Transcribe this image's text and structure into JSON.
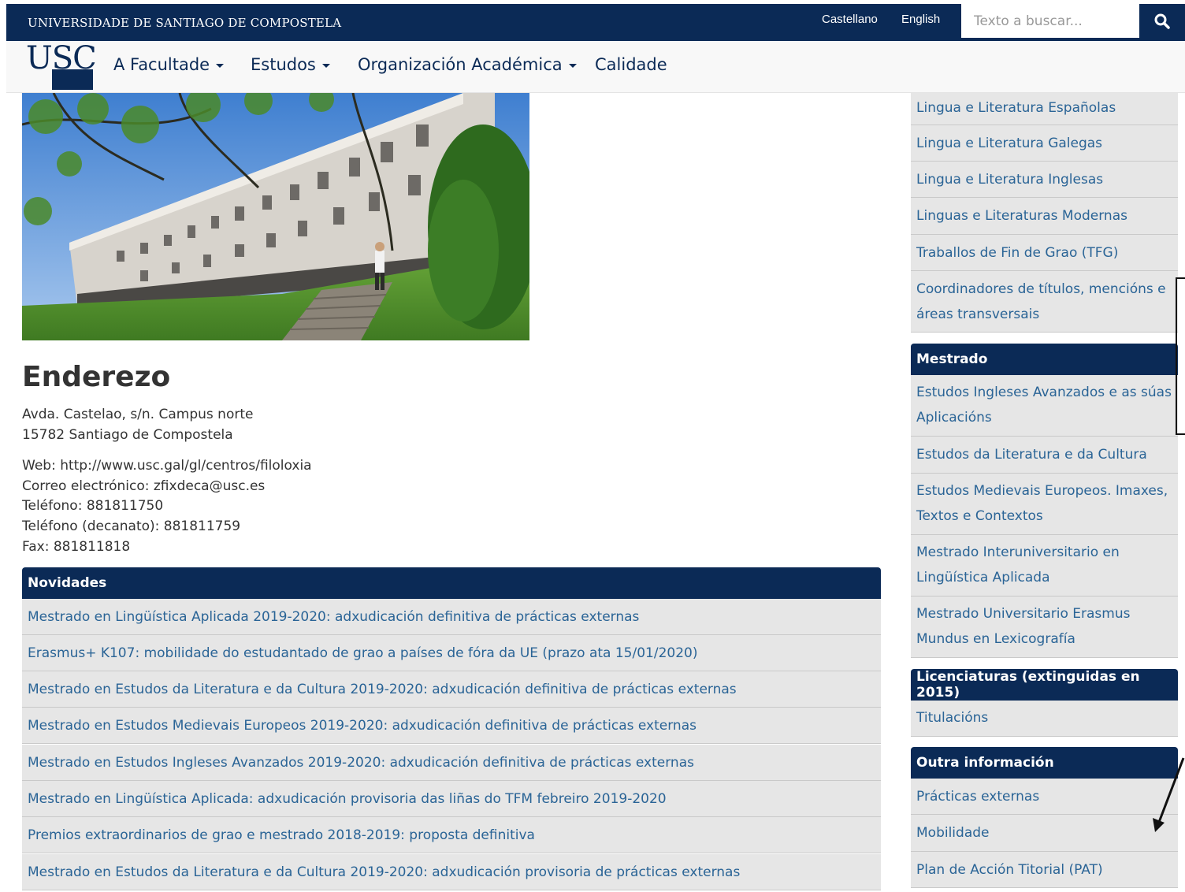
{
  "header": {
    "university": "UNIVERSIDADE DE SANTIAGO DE COMPOSTELA",
    "languages": [
      "Castellano",
      "English"
    ],
    "search_placeholder": "Texto a buscar..."
  },
  "logo": {
    "text": "USC"
  },
  "nav": {
    "items": [
      {
        "label": "A Facultade",
        "dropdown": true
      },
      {
        "label": "Estudos",
        "dropdown": true
      },
      {
        "label": "Organización Académica",
        "dropdown": true
      },
      {
        "label": "Calidade",
        "dropdown": false
      }
    ]
  },
  "address": {
    "title": "Enderezo",
    "line1": "Avda. Castelao, s/n. Campus norte",
    "line2": "15782 Santiago de Compostela",
    "web": "Web: http://www.usc.gal/gl/centros/filoloxia",
    "email": "Correo electrónico: zfixdeca@usc.es",
    "phone": "Teléfono: 881811750",
    "phone_dean": "Teléfono (decanato): 881811759",
    "fax": "Fax: 881811818"
  },
  "news": {
    "title": "Novidades",
    "items": [
      "Mestrado en Lingüística Aplicada 2019-2020: adxudicación definitiva de prácticas externas",
      "Erasmus+ K107: mobilidade do estudantado de grao a países de fóra da UE (prazo ata 15/01/2020)",
      "Mestrado en Estudos da Literatura e da Cultura 2019-2020: adxudicación definitiva de prácticas externas",
      "Mestrado en Estudos Medievais Europeos 2019-2020: adxudicación definitiva de prácticas externas",
      "Mestrado en Estudos Ingleses Avanzados 2019-2020: adxudicación definitiva de prácticas externas",
      "Mestrado en Lingüística Aplicada: adxudicación provisoria das liñas do TFM febreiro 2019-2020",
      "Premios extraordinarios de grao e mestrado 2018-2019: proposta definitiva",
      "Mestrado en Estudos da Literatura e da Cultura 2019-2020: adxudicación provisoria de prácticas externas"
    ]
  },
  "sidebar": {
    "grao_items": [
      "Lingua e Literatura Españolas",
      "Lingua e Literatura Galegas",
      "Lingua e Literatura Inglesas",
      "Linguas e Literaturas Modernas",
      "Traballos de Fin de Grao (TFG)",
      "Coordinadores de títulos, mencións e áreas transversais"
    ],
    "mestrado_title": "Mestrado",
    "mestrado_items": [
      "Estudos Ingleses Avanzados e as súas Aplicacións",
      "Estudos da Literatura e da Cultura",
      "Estudos Medievais Europeos. Imaxes, Textos e Contextos",
      "Mestrado Interuniversitario en Lingüística Aplicada",
      "Mestrado Universitario Erasmus Mundus en Lexicografía"
    ],
    "licenciaturas_title": "Licenciaturas (extinguidas en 2015)",
    "licenciaturas_items": [
      "Titulacións"
    ],
    "outra_title": "Outra información",
    "outra_items": [
      "Prácticas externas",
      "Mobilidade",
      "Plan de Acción Titorial (PAT)"
    ]
  },
  "colors": {
    "brand": "#0b2a56",
    "link": "#2a6496",
    "panel_bg": "#e6e6e6"
  }
}
